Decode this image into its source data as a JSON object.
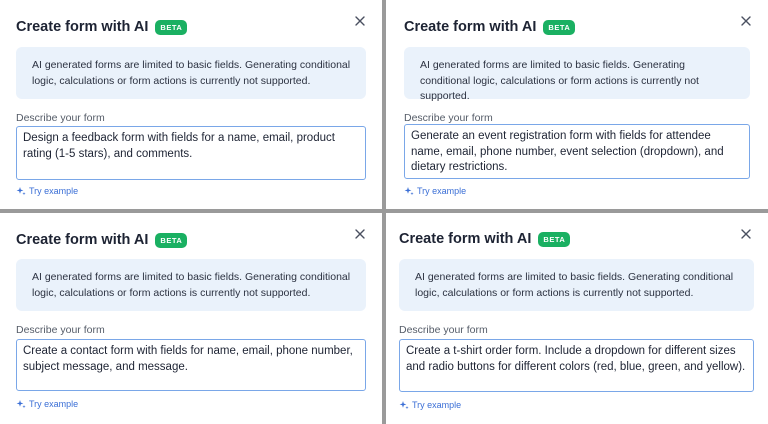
{
  "panels": [
    {
      "title": "Create form with AI",
      "badge": "BETA",
      "notice": "AI generated forms are limited to basic fields. Generating conditional logic, calculations or form actions is currently not supported.",
      "field_label": "Describe your form",
      "prompt_value": "Design a feedback form with fields for a name, email, product rating (1-5 stars), and comments.",
      "try_example": "Try example"
    },
    {
      "title": "Create form with AI",
      "badge": "BETA",
      "notice": "AI generated forms are limited to basic fields. Generating conditional logic, calculations or form actions is currently not supported.",
      "field_label": "Describe your form",
      "prompt_value": "Generate an event registration form with fields for attendee name, email, phone number, event selection (dropdown), and dietary restrictions.",
      "try_example": "Try example"
    },
    {
      "title": "Create form with AI",
      "badge": "BETA",
      "notice": "AI generated forms are limited to basic fields. Generating conditional logic, calculations or form actions is currently not supported.",
      "field_label": "Describe your form",
      "prompt_value": "Create a contact form with fields for name, email, phone number, subject message, and message.",
      "try_example": "Try example"
    },
    {
      "title": "Create form with AI",
      "badge": "BETA",
      "notice": "AI generated forms are limited to basic fields. Generating conditional logic, calculations or form actions is currently not supported.",
      "field_label": "Describe your form",
      "prompt_value": "Create a t-shirt order form. Include a dropdown for different sizes and radio buttons for different colors (red, blue, green, and yellow).",
      "try_example": "Try example"
    }
  ],
  "colors": {
    "beta_badge": "#1ab062",
    "notice_bg": "#eaf2fb",
    "link": "#3b6fd6",
    "textarea_border": "#7aa7e8"
  },
  "icons": {
    "close": "close-icon",
    "sparkle": "sparkle-icon",
    "resize": "resize-handle-icon"
  }
}
